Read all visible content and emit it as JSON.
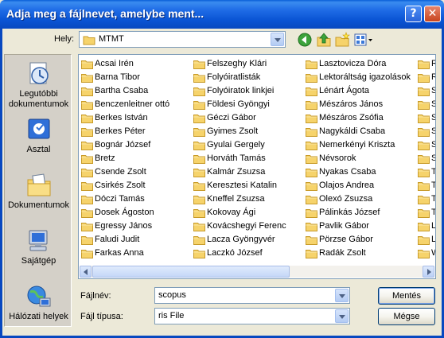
{
  "window": {
    "title": "Adja meg a fájlnevet, amelybe ment...",
    "help_label": "?",
    "close_label": "✕"
  },
  "lookin": {
    "label": "Hely:",
    "value": "MTMT"
  },
  "toolbar": {
    "icons": [
      "back-icon",
      "up-folder-icon",
      "new-folder-icon",
      "views-menu-icon"
    ]
  },
  "places": [
    {
      "label": "Legutóbbi dokumentumok",
      "icon": "recent-docs-icon"
    },
    {
      "label": "Asztal",
      "icon": "desktop-icon"
    },
    {
      "label": "Dokumentumok",
      "icon": "my-documents-icon"
    },
    {
      "label": "Sajátgép",
      "icon": "my-computer-icon"
    },
    {
      "label": "Hálózati helyek",
      "icon": "network-places-icon"
    }
  ],
  "files": {
    "col1": [
      "Acsai Irén",
      "Barna Tibor",
      "Bartha Csaba",
      "Benczenleitner ottó",
      "Berkes István",
      "Berkes Péter",
      "Bognár József",
      "Bretz",
      "Csende Zsolt",
      "Csirkés Zsolt",
      "Dóczi Tamás",
      "Dosek Ágoston",
      "Egressy János",
      "Faludi Judit",
      "Farkas Anna"
    ],
    "col2": [
      "Felszeghy Klári",
      "Folyóiratlisták",
      "Folyóiratok linkjei",
      "Földesi Gyöngyi",
      "Géczi Gábor",
      "Gyimes Zsolt",
      "Gyulai Gergely",
      "Horváth Tamás",
      "Kalmár Zsuzsa",
      "Keresztesi Katalin",
      "Kneffel Zsuzsa",
      "Kokovay Ági",
      "Kovácshegyi Ferenc",
      "Lacza Gyöngyvér",
      "Laczkó József"
    ],
    "col3": [
      "Lasztovicza Dóra",
      "Lektoráltság igazolások",
      "Lénárt Ágota",
      "Mészáros János",
      "Mészáros Zsófia",
      "Nagykáldi Csaba",
      "Nemerkényi Krisztа",
      "Névsorok",
      "Nyakas Csaba",
      "Olajos Andrea",
      "Olexó Zsuzsa",
      "Pálinkás József",
      "Pavlik Gábor",
      "Pörzse Gábor",
      "Radák Zsolt"
    ],
    "col4": [
      "R",
      "R",
      "S",
      "S",
      "S",
      "S",
      "S",
      "S",
      "T",
      "T",
      "T",
      "T",
      "L",
      "L",
      "W"
    ]
  },
  "filename": {
    "label": "Fájlnév:",
    "value": "scopus"
  },
  "filetype": {
    "label": "Fájl típusa:",
    "value": "ris File"
  },
  "buttons": {
    "save": "Mentés",
    "cancel": "Mégse"
  },
  "colors": {
    "titlebar": "#0A54D4",
    "dialog_bg": "#ECE9D8",
    "folder": "#F6D36B"
  }
}
